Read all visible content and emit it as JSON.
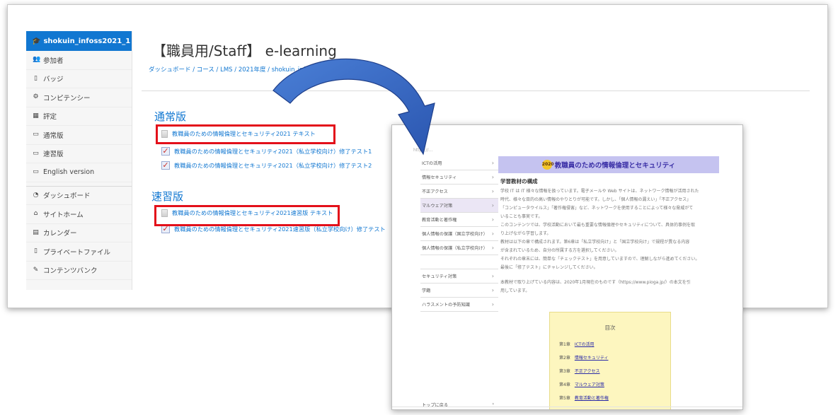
{
  "sidebar": {
    "course_label": "shokuin_infoss2021_1",
    "items_top": [
      {
        "icon": "people",
        "label": "参加者"
      },
      {
        "icon": "badge",
        "label": "バッジ"
      },
      {
        "icon": "competency",
        "label": "コンピテンシー"
      },
      {
        "icon": "grades",
        "label": "評定"
      },
      {
        "icon": "folder",
        "label": "通常版"
      },
      {
        "icon": "folder",
        "label": "速習版"
      },
      {
        "icon": "folder",
        "label": "English version"
      }
    ],
    "items_bottom": [
      {
        "icon": "dashboard",
        "label": "ダッシュボード"
      },
      {
        "icon": "home",
        "label": "サイトホーム"
      },
      {
        "icon": "calendar",
        "label": "カレンダー"
      },
      {
        "icon": "file",
        "label": "プライベートファイル"
      },
      {
        "icon": "bank",
        "label": "コンテンツバンク"
      }
    ]
  },
  "main": {
    "title": "【職員用/Staff】 e-learning",
    "breadcrumb": "ダッシュボード / コース / LMS / 2021年度 / shokuin_infoss2021_1",
    "sections": [
      {
        "title": "通常版",
        "activities": [
          {
            "type": "page",
            "label": "教職員のための情報倫理とセキュリティ2021 テキスト"
          },
          {
            "type": "quiz",
            "label": "教職員のための情報倫理とセキュリティ2021（私立学校向け）修了テスト1"
          },
          {
            "type": "quiz",
            "label": "教職員のための情報倫理とセキュリティ2021（私立学校向け）修了テスト2"
          }
        ]
      },
      {
        "title": "速習版",
        "activities": [
          {
            "type": "page",
            "label": "教職員のための情報倫理とセキュリティ2021速習版 テキスト"
          },
          {
            "type": "quiz",
            "label": "教職員のための情報倫理とセキュリティ2021速習版（私立学校向け）修了テスト"
          }
        ]
      }
    ]
  },
  "textbook": {
    "url": "https://...",
    "banner_year": "2020",
    "banner_title": "教職員のための情報倫理とセキュリティ",
    "nav": [
      {
        "label": "ICTの活用"
      },
      {
        "label": "情報セキュリティ"
      },
      {
        "label": "不正アクセス"
      },
      {
        "label": "マルウェア対策",
        "active": true
      },
      {
        "label": "教育活動と著作権"
      },
      {
        "label": "個人情報の保護（国立学校向け）"
      },
      {
        "label": "個人情報の保護（私立学校向け）"
      },
      {
        "label": ""
      },
      {
        "label": "セキュリティ対策"
      },
      {
        "label": "学籍"
      },
      {
        "label": "ハラスメントの予防知識"
      }
    ],
    "nav_back": "トップに戻る",
    "heading": "学習教材の構成",
    "paragraphs": [
      "学校 IT は IT 様々な情報を扱っています。電子メールや Web サイトは、ネットワーク情報が活用された",
      "時代、様々な目的の高い情報のやりとりが可能です。しかし、「個人情報の漏えい」「不正アクセス」",
      "「コンピュータウイルス」「著作権侵害」など、ネットワークを使用することによって様々な脅威がて",
      "いることも事実です。",
      "このコンテンツでは、学校活動において最も重要な情報倫理やセキュリティについて、具体的事例を取",
      "り上げながら学習します。",
      "教材は以下の章で構成されます。第6章は「私立学校向け」と「国立学校向け」で規程が異なる内容",
      "が含まれているため、自分の所属する方を選択してください。",
      "それぞれの章末には、簡単な「チェックテスト」を用意していますので、理解しながら進めてください。",
      "最後に「修了テスト」にチャレンジしてください。",
      "",
      "本教材で取り上げている内容は、2020年1月現在のものです（https://www.pioga.jp/）の本文を引",
      "用しています。"
    ],
    "toc_title": "目次",
    "toc": [
      {
        "num": "第1章",
        "label": "ICTの活用"
      },
      {
        "num": "第2章",
        "label": "情報セキュリティ"
      },
      {
        "num": "第3章",
        "label": "不正アクセス"
      },
      {
        "num": "第4章",
        "label": "マルウェア対策"
      },
      {
        "num": "第5章",
        "label": "教育活動と著作権"
      }
    ]
  }
}
